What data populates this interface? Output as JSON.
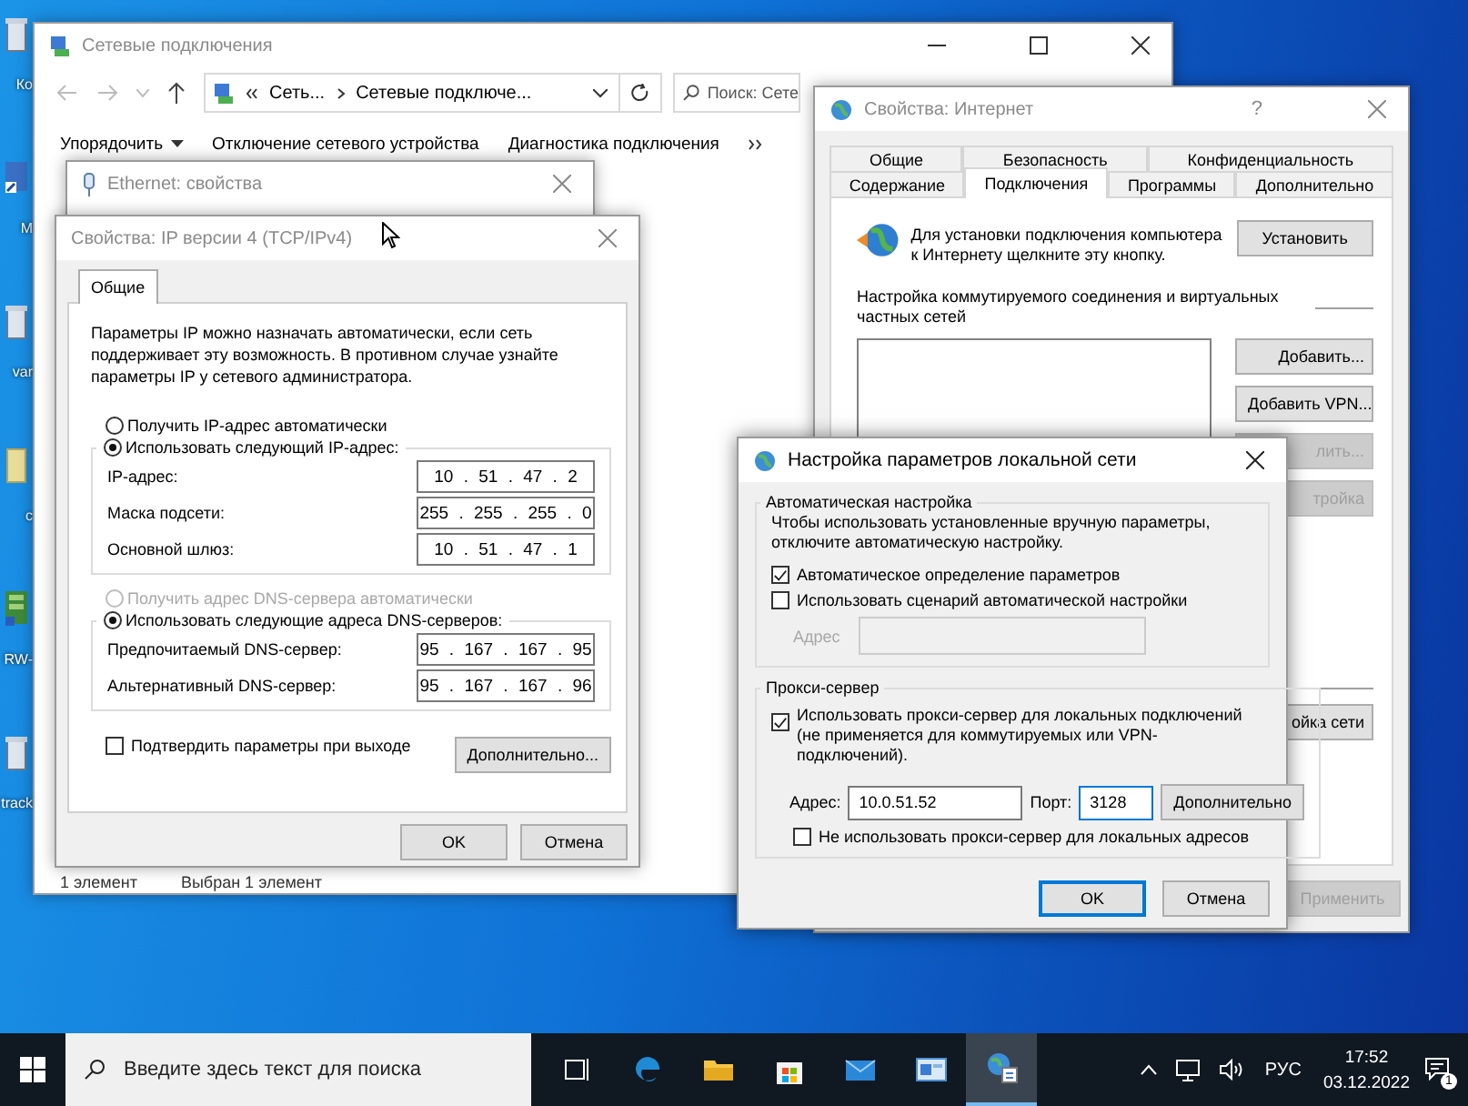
{
  "desktop_icons": [
    {
      "kind": "bin",
      "label": "Ко"
    },
    {
      "kind": "shortcut",
      "label": "M"
    },
    {
      "kind": "bin",
      "label": "var"
    },
    {
      "kind": "file",
      "label": "c"
    },
    {
      "kind": "app",
      "label": "RW-"
    },
    {
      "kind": "bin",
      "label": "track"
    }
  ],
  "explorer": {
    "title": "Сетевые подключения",
    "active": false,
    "path": [
      "Сеть...",
      "Сетевые подключе..."
    ],
    "search_placeholder": "Поиск: Сете",
    "toolbar": [
      "Упорядочить",
      "Отключение сетевого устройства",
      "Диагностика подключения"
    ],
    "status": [
      "1 элемент",
      "Выбран 1 элемент"
    ]
  },
  "ethernet_window": {
    "title": "Ethernet: свойства",
    "active": false
  },
  "ip_dialog": {
    "title": "Свойства: IP версии 4 (TCP/IPv4)",
    "active": false,
    "tabs": [
      {
        "label": "Общие",
        "selected": true
      }
    ],
    "intro": "Параметры IP можно назначать автоматически, если сеть поддерживает эту возможность. В противном случае узнайте параметры IP у сетевого администратора.",
    "ip_options": [
      {
        "label": "Получить IP-адрес автоматически",
        "selected": false,
        "disabled": false
      },
      {
        "label": "Использовать следующий IP-адрес:",
        "selected": true,
        "disabled": false
      }
    ],
    "ip_fields": [
      {
        "label": "IP-адрес:",
        "value": "10 . 51 . 47 . 2"
      },
      {
        "label": "Маска подсети:",
        "value": "255 . 255 . 255 . 0"
      },
      {
        "label": "Основной шлюз:",
        "value": "10 . 51 . 47 . 1"
      }
    ],
    "dns_options": [
      {
        "label": "Получить адрес DNS-сервера автоматически",
        "selected": false,
        "disabled": true
      },
      {
        "label": "Использовать следующие адреса DNS-серверов:",
        "selected": true,
        "disabled": false
      }
    ],
    "dns_fields": [
      {
        "label": "Предпочитаемый DNS-сервер:",
        "value": "95 . 167 . 167 . 95"
      },
      {
        "label": "Альтернативный DNS-сервер:",
        "value": "95 . 167 . 167 . 96"
      }
    ],
    "validate": {
      "label": "Подтвердить параметры при выходе",
      "checked": false
    },
    "advanced_button": "Дополнительно...",
    "buttons": [
      "OK",
      "Отмена"
    ]
  },
  "internet_dialog": {
    "title": "Свойства: Интернет",
    "active": false,
    "help_button": "?",
    "tab_rows": [
      {
        "tabs": [
          {
            "label": "Общие",
            "selected": false
          },
          {
            "label": "Безопасность",
            "selected": false
          },
          {
            "label": "Конфиденциальность",
            "selected": false
          }
        ]
      },
      {
        "tabs": [
          {
            "label": "Содержание",
            "selected": false
          },
          {
            "label": "Подключения",
            "selected": true
          },
          {
            "label": "Программы",
            "selected": false
          },
          {
            "label": "Дополнительно",
            "selected": false
          }
        ]
      }
    ],
    "setup_text": "Для установки подключения компьютера к Интернету щелкните эту кнопку.",
    "setup_button": "Установить",
    "vpn_heading": "Настройка коммутируемого соединения и виртуальных частных сетей",
    "side_buttons": [
      {
        "label": "Добавить...",
        "disabled": false
      },
      {
        "label": "Добавить VPN...",
        "disabled": false
      },
      {
        "label": "лить...",
        "disabled": true
      },
      {
        "label": "тройка",
        "disabled": true
      }
    ],
    "lan_button": {
      "label": "ойка сети",
      "disabled": false
    },
    "apply_button": {
      "label": "Применить",
      "disabled": true
    }
  },
  "lan_dialog": {
    "title": "Настройка параметров локальной сети",
    "active": true,
    "auto_group": {
      "title": "Автоматическая настройка",
      "note": "Чтобы использовать установленные вручную параметры, отключите автоматическую настройку.",
      "options": [
        {
          "label": "Автоматическое определение параметров",
          "checked": true
        },
        {
          "label": "Использовать сценарий автоматической настройки",
          "checked": false
        }
      ],
      "address": {
        "label": "Адрес",
        "disabled": true
      }
    },
    "proxy_group": {
      "title": "Прокси-сервер",
      "use_proxy": {
        "label": "Использовать прокси-сервер для локальных подключений (не применяется для коммутируемых или VPN-подключений).",
        "checked": true
      },
      "address": {
        "label": "Адрес:",
        "value": "10.0.51.52"
      },
      "port": {
        "label": "Порт:",
        "value": "3128"
      },
      "advanced_button": "Дополнительно",
      "bypass": {
        "label": "Не использовать прокси-сервер для локальных адресов",
        "checked": false
      }
    },
    "buttons": [
      {
        "label": "OK",
        "default": true
      },
      {
        "label": "Отмена",
        "default": false
      }
    ]
  },
  "taskbar": {
    "search_placeholder": "Введите здесь текст для поиска",
    "apps": [
      {
        "kind": "taskview",
        "selected": false
      },
      {
        "kind": "edge",
        "selected": false
      },
      {
        "kind": "folder",
        "selected": false
      },
      {
        "kind": "store",
        "selected": false
      },
      {
        "kind": "mail",
        "selected": false
      },
      {
        "kind": "control",
        "selected": false
      },
      {
        "kind": "network",
        "selected": true
      }
    ],
    "language": "РУС",
    "time": "17:52",
    "date": "03.12.2022",
    "notifications": "1"
  }
}
